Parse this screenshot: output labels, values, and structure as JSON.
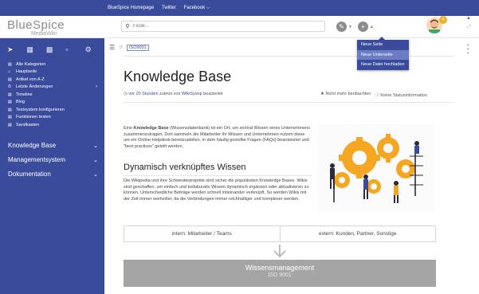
{
  "topbar": {
    "links": [
      "BlueSpice Homepage",
      "Twitter",
      "Facebook ⌵"
    ]
  },
  "header": {
    "logo_main": "BlueSpice",
    "logo_sub": "MediaWiki",
    "search_placeholder": "Finde...",
    "badge_count": "4"
  },
  "dropdown": {
    "items": [
      "Neue Seite",
      "Neue Unterseite",
      "Neue Datei hochladen"
    ],
    "active_index": 1
  },
  "sidebar": {
    "items": [
      {
        "icon": "list",
        "label": "Alle Kategorien"
      },
      {
        "icon": "home",
        "label": "Hauptseite"
      },
      {
        "icon": "list",
        "label": "Artikel von A-Z"
      },
      {
        "icon": "history",
        "label": "Letzte Änderungen"
      },
      {
        "icon": "list",
        "label": "Timeline"
      },
      {
        "icon": "list",
        "label": "Blog"
      },
      {
        "icon": "list",
        "label": "Testsystem konfigurieren"
      },
      {
        "icon": "list",
        "label": "Funktionen testen"
      },
      {
        "icon": "list",
        "label": "Sandkasten"
      }
    ],
    "sections": [
      "Knowledge Base",
      "Managementsystem",
      "Dokumentation"
    ]
  },
  "page": {
    "breadcrumb_tag": "ISO9001",
    "title": "Knowledge Base",
    "meta_prefix": "vor 20 Stunden",
    "meta_mid": " zuletzt von ",
    "meta_user": "WikiSysop",
    "meta_suffix": " bearbeitet",
    "watch_label": "Nicht mehr beobachten",
    "status_label": "Keine Statusinformation",
    "intro_bold": "Knowledge Base",
    "intro_pre": "Eine ",
    "intro_text": " (Wissensdatenbank) ist ein Ort, um zentral Wissen eines Unternehmens zusammenzutragen. Dort sammeln die Mitarbeiter ihr Wissen und Unternehmen nutzen diese um ein Online-Helpdesk bereitzustellen, in dem häufig gestellte Fragen (FAQs) beantwortet und \"best practices\" geteilt werden.",
    "subheading": "Dynamisch verknüpftes Wissen",
    "body2": "Die Wikipedia und ihre Schwesterprojekte sind sicher die populärsten Knowledge Bases. Wikis sind geschaffen, um einfach und kollaborativ Wissen dynamisch ergänzen oder aktualisieren zu können. Unterschiedliche Beiträge werden schnell miteinander verknüpft. So werden Wikis mit der Zeit immer wertvoller, da die Verbindungen immer reichhaltiger und komplexer werden.",
    "table_left": "intern: Mitarbeiter / Teams",
    "table_right": "extern: Kunden, Partner, Sonstige",
    "box_title": "Wissensmanagement",
    "box_sub": "ISO 9001"
  },
  "colors": {
    "brand": "#3b4b9b",
    "dropdown_active": "#6c7cc4",
    "illustration_orange": "#f5a623"
  }
}
